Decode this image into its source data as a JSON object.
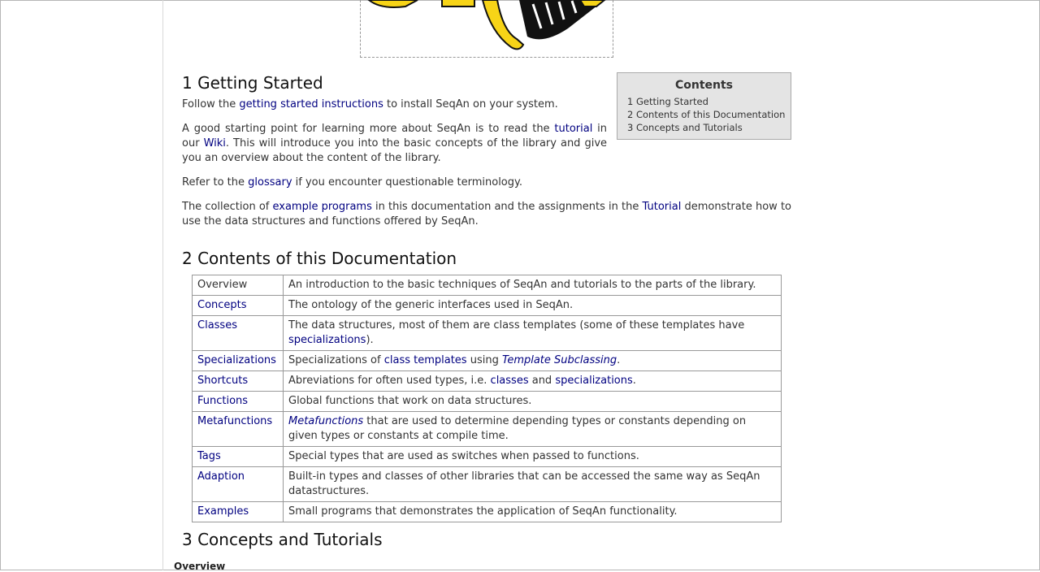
{
  "logo": {
    "alt_icon": "seqan-dna-logo-icon"
  },
  "section1": {
    "heading": "1 Getting Started",
    "p1": {
      "pre": "Follow the ",
      "link": "getting started instructions",
      "post": " to install SeqAn on your system."
    },
    "p2": {
      "a": "A good starting point for learning more about SeqAn is to read the ",
      "link1": "tutorial",
      "b": " in our ",
      "link2": "Wiki",
      "c": ". This will introduce you into the basic concepts of the library and give you an overview about the content of the library."
    },
    "p3": {
      "pre": "Refer to the ",
      "link": "glossary",
      "post": " if you encounter questionable terminology."
    },
    "p4": {
      "a": "The collection of ",
      "link1": "example programs",
      "b": " in this documentation and the assignments in the ",
      "link2": "Tutorial",
      "c": " demonstrate how to use the data structures and functions offered by SeqAn."
    }
  },
  "toc": {
    "title": "Contents",
    "items": [
      "1 Getting Started",
      "2 Contents of this Documentation",
      "3 Concepts and Tutorials"
    ]
  },
  "section2": {
    "heading": "2 Contents of this Documentation",
    "rows": [
      {
        "name": "Overview",
        "desc": "An introduction to the basic techniques of SeqAn and tutorials to the parts of the library."
      },
      {
        "name": "Concepts",
        "desc": "The ontology of the generic interfaces used in SeqAn."
      },
      {
        "name": "Classes",
        "desc_a": "The data structures, most of them are class templates (some of these templates have ",
        "desc_link": "specializations",
        "desc_b": ")."
      },
      {
        "name": "Specializations",
        "desc_a": "Specializations of ",
        "desc_link": "class templates",
        "desc_b": " using ",
        "desc_ital": "Template Subclassing",
        "desc_c": "."
      },
      {
        "name": "Shortcuts",
        "desc_a": "Abreviations for often used types, i.e. ",
        "desc_link1": "classes",
        "desc_b": " and ",
        "desc_link2": "specializations",
        "desc_c": "."
      },
      {
        "name": "Functions",
        "desc": "Global functions that work on data structures."
      },
      {
        "name": "Metafunctions",
        "desc_ital": "Metafunctions",
        "desc_b": " that are used to determine depending types or constants depending on given types or constants at compile time."
      },
      {
        "name": "Tags",
        "desc": "Special types that are used as switches when passed to functions."
      },
      {
        "name": "Adaption",
        "desc": "Built-in types and classes of other libraries that can be accessed the same way as SeqAn datastructures."
      },
      {
        "name": "Examples",
        "desc": "Small programs that demonstrates the application of SeqAn functionality."
      }
    ]
  },
  "section3": {
    "heading": "3 Concepts and Tutorials",
    "subheading": "Overview"
  },
  "colors": {
    "link": "#000080",
    "toc_bg": "#e4e4e4",
    "logo_yellow": "#f7d417"
  }
}
